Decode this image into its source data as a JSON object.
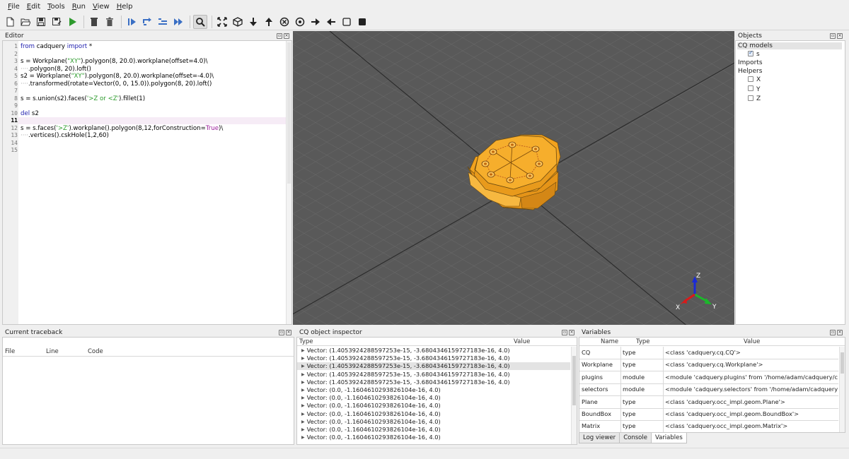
{
  "menu": [
    {
      "label": "File",
      "underline": "F",
      "rest": "ile"
    },
    {
      "label": "Edit",
      "underline": "E",
      "rest": "dit"
    },
    {
      "label": "Tools",
      "underline": "T",
      "rest": "ools"
    },
    {
      "label": "Run",
      "underline": "R",
      "rest": "un"
    },
    {
      "label": "View",
      "underline": "V",
      "rest": "iew"
    },
    {
      "label": "Help",
      "underline": "H",
      "rest": "elp"
    }
  ],
  "editor": {
    "title": "Editor",
    "line_numbers": [
      "1",
      "2",
      "3",
      "4",
      "5",
      "6",
      "7",
      "8",
      "9",
      "10",
      "11",
      "12",
      "13",
      "14",
      "15"
    ],
    "current_line": "11",
    "lines": [
      [
        {
          "t": "from",
          "c": "kw"
        },
        {
          "t": " cadquery "
        },
        {
          "t": "import",
          "c": "kw"
        },
        {
          "t": " *"
        }
      ],
      [],
      [
        {
          "t": "s = Workplane("
        },
        {
          "t": "\"XY\"",
          "c": "st"
        },
        {
          "t": ").polygon(8, 20.0).workplane(offset=4.0)\\"
        }
      ],
      [
        {
          "t": "····",
          "c": "cont"
        },
        {
          "t": ".polygon(8, 20).loft()"
        }
      ],
      [
        {
          "t": "s2 = Workplane("
        },
        {
          "t": "\"XY\"",
          "c": "st"
        },
        {
          "t": ").polygon(8, 20.0).workplane(offset=-4.0)\\"
        }
      ],
      [
        {
          "t": "····",
          "c": "cont"
        },
        {
          "t": ".transformed(rotate=Vector(0, 0, 15.0)).polygon(8, 20).loft()"
        }
      ],
      [],
      [
        {
          "t": "s = s.union(s2).faces("
        },
        {
          "t": "'>Z or <Z'",
          "c": "st"
        },
        {
          "t": ").fillet(1)"
        }
      ],
      [],
      [
        {
          "t": "del",
          "c": "kw"
        },
        {
          "t": " s2"
        }
      ],
      [],
      [
        {
          "t": "s = s.faces("
        },
        {
          "t": "'>Z'",
          "c": "st"
        },
        {
          "t": ").workplane().polygon(8,12,forConstruction="
        },
        {
          "t": "True",
          "c": "tr"
        },
        {
          "t": ")\\"
        }
      ],
      [
        {
          "t": "····",
          "c": "cont"
        },
        {
          "t": ".vertices().cskHole(1,2,60)"
        }
      ],
      [],
      []
    ]
  },
  "objects": {
    "title": "Objects",
    "sections": [
      {
        "label": "CQ models",
        "items": [
          {
            "label": "s",
            "checked": true
          }
        ]
      },
      {
        "label": "Imports",
        "items": []
      },
      {
        "label": "Helpers",
        "items": [
          {
            "label": "X",
            "checked": false
          },
          {
            "label": "Y",
            "checked": false
          },
          {
            "label": "Z",
            "checked": false
          }
        ]
      }
    ]
  },
  "axes_triad": {
    "x": "X",
    "y": "Y",
    "z": "Z"
  },
  "traceback": {
    "title": "Current traceback",
    "columns": [
      "File",
      "Line",
      "Code"
    ]
  },
  "inspector": {
    "title": "CQ object inspector",
    "columns": [
      "Type",
      "Value"
    ],
    "selected_index": 2,
    "rows": [
      "Vector: (1.4053924288597253e-15, -3.6804346159727183e-16, 4.0)",
      "Vector: (1.4053924288597253e-15, -3.6804346159727183e-16, 4.0)",
      "Vector: (1.4053924288597253e-15, -3.6804346159727183e-16, 4.0)",
      "Vector: (1.4053924288597253e-15, -3.6804346159727183e-16, 4.0)",
      "Vector: (1.4053924288597253e-15, -3.6804346159727183e-16, 4.0)",
      "Vector: (0.0, -1.1604610293826104e-16, 4.0)",
      "Vector: (0.0, -1.1604610293826104e-16, 4.0)",
      "Vector: (0.0, -1.1604610293826104e-16, 4.0)",
      "Vector: (0.0, -1.1604610293826104e-16, 4.0)",
      "Vector: (0.0, -1.1604610293826104e-16, 4.0)",
      "Vector: (0.0, -1.1604610293826104e-16, 4.0)",
      "Vector: (0.0, -1.1604610293826104e-16, 4.0)"
    ]
  },
  "variables": {
    "title": "Variables",
    "columns": [
      "Name",
      "Type",
      "Value"
    ],
    "rows": [
      [
        "CQ",
        "type",
        "<class 'cadquery.cq.CQ'>"
      ],
      [
        "Workplane",
        "type",
        "<class 'cadquery.cq.Workplane'>"
      ],
      [
        "plugins",
        "module",
        "<module 'cadquery.plugins' from '/home/adam/cadquery/c..."
      ],
      [
        "selectors",
        "module",
        "<module 'cadquery.selectors' from '/home/adam/cadquery/..."
      ],
      [
        "Plane",
        "type",
        "<class 'cadquery.occ_impl.geom.Plane'>"
      ],
      [
        "BoundBox",
        "type",
        "<class 'cadquery.occ_impl.geom.BoundBox'>"
      ],
      [
        "Matrix",
        "type",
        "<class 'cadquery.occ_impl.geom.Matrix'>"
      ]
    ],
    "tabs": [
      "Log viewer",
      "Console",
      "Variables"
    ],
    "active_tab": "Variables"
  },
  "colors": {
    "model_fill": "#f0a51e",
    "model_dark": "#d88a10",
    "viewport_bg": "#595959",
    "grid": "#6a6a6a"
  }
}
